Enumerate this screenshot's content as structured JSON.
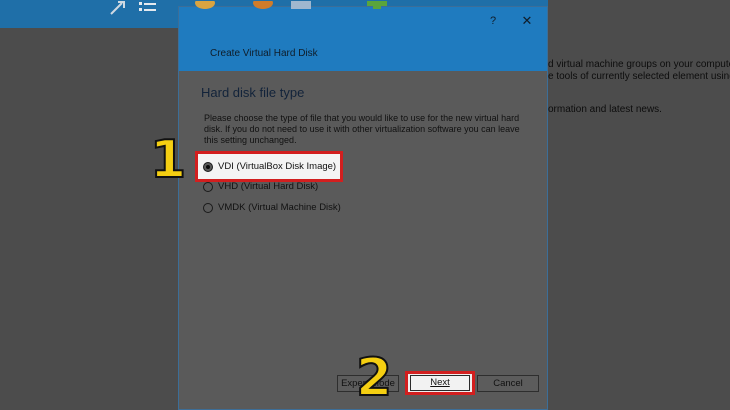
{
  "background": {
    "side_text_lines": [
      "d virtual machine groups on your computer",
      "e tools of currently selected element using",
      "ormation and latest news."
    ]
  },
  "dialog": {
    "title": "Create Virtual Hard Disk",
    "help_label": "?",
    "close_label": "✕",
    "heading": "Hard disk file type",
    "description": "Please choose the type of file that you would like to use for the new virtual hard disk. If you do not need to use it with other virtualization software you can leave this setting unchanged.",
    "options": [
      {
        "label": "VDI (VirtualBox Disk Image)",
        "selected": true
      },
      {
        "label": "VHD (Virtual Hard Disk)",
        "selected": false
      },
      {
        "label": "VMDK (Virtual Machine Disk)",
        "selected": false
      }
    ],
    "buttons": {
      "expert_label": "Expert Mode",
      "next_label": "Next",
      "cancel_label": "Cancel"
    }
  },
  "annotations": {
    "step1": "1",
    "step2": "2",
    "highlight_color": "#d21f1f",
    "number_color": "#f5cf12"
  }
}
